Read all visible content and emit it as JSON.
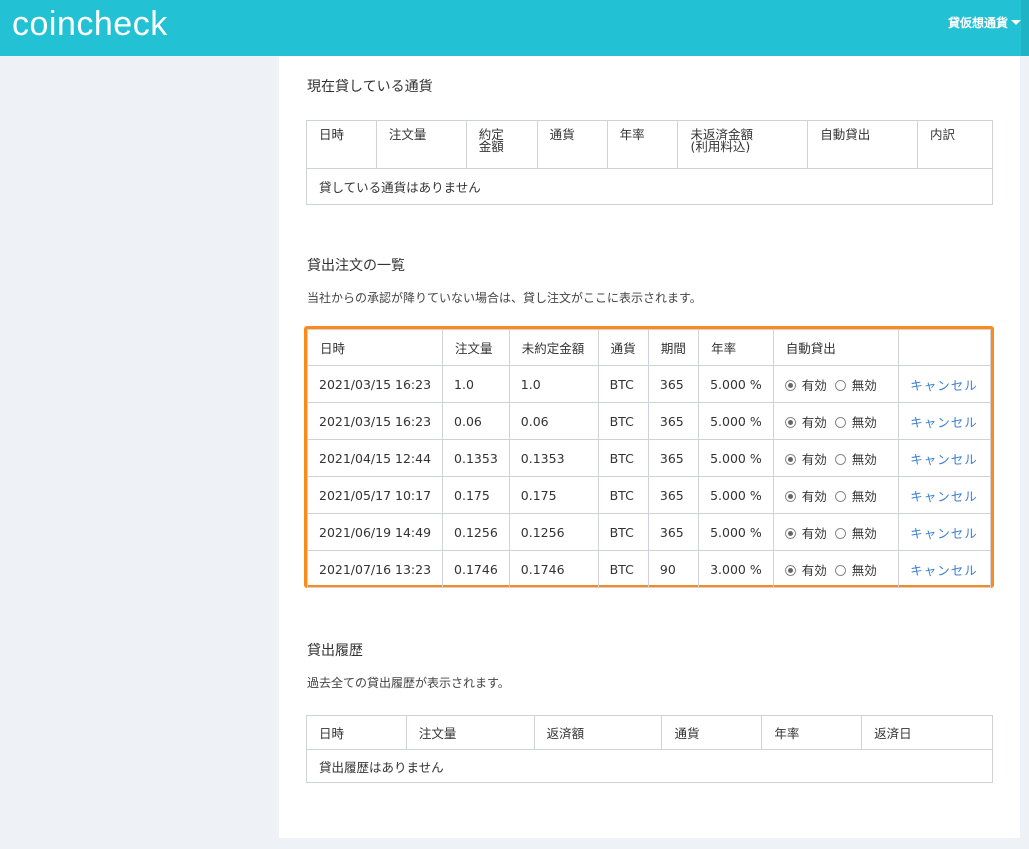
{
  "header": {
    "logo": "coincheck",
    "menu_label": "貸仮想通貨"
  },
  "current_lending": {
    "title": "現在貸している通貨",
    "columns": [
      "日時",
      "注文量",
      "約定\n金額",
      "通貨",
      "年率",
      "未返済金額\n(利用料込)",
      "自動貸出",
      "内訳"
    ],
    "empty_text": "貸している通貨はありません"
  },
  "orders": {
    "title": "貸出注文の一覧",
    "description": "当社からの承認が降りていない場合は、貸し注文がここに表示されます。",
    "columns": [
      "日時",
      "注文量",
      "未約定金額",
      "通貨",
      "期間",
      "年率",
      "自動貸出",
      ""
    ],
    "radio_on_label": "有効",
    "radio_off_label": "無効",
    "cancel_label": "キャンセル",
    "rows": [
      {
        "date": "2021/03/15 16:23",
        "amount": "1.0",
        "unfilled": "1.0",
        "currency": "BTC",
        "period": "365",
        "rate": "5.000 %"
      },
      {
        "date": "2021/03/15 16:23",
        "amount": "0.06",
        "unfilled": "0.06",
        "currency": "BTC",
        "period": "365",
        "rate": "5.000 %"
      },
      {
        "date": "2021/04/15 12:44",
        "amount": "0.1353",
        "unfilled": "0.1353",
        "currency": "BTC",
        "period": "365",
        "rate": "5.000 %"
      },
      {
        "date": "2021/05/17 10:17",
        "amount": "0.175",
        "unfilled": "0.175",
        "currency": "BTC",
        "period": "365",
        "rate": "5.000 %"
      },
      {
        "date": "2021/06/19 14:49",
        "amount": "0.1256",
        "unfilled": "0.1256",
        "currency": "BTC",
        "period": "365",
        "rate": "5.000 %"
      },
      {
        "date": "2021/07/16 13:23",
        "amount": "0.1746",
        "unfilled": "0.1746",
        "currency": "BTC",
        "period": "90",
        "rate": "3.000 %"
      }
    ]
  },
  "history": {
    "title": "貸出履歴",
    "description": "過去全ての貸出履歴が表示されます。",
    "columns": [
      "日時",
      "注文量",
      "返済額",
      "通貨",
      "年率",
      "返済日"
    ],
    "empty_text": "貸出履歴はありません"
  },
  "colors": {
    "header_bg": "#23c1d4",
    "highlight_border": "#fb8a1b",
    "link": "#3c7fcf"
  }
}
